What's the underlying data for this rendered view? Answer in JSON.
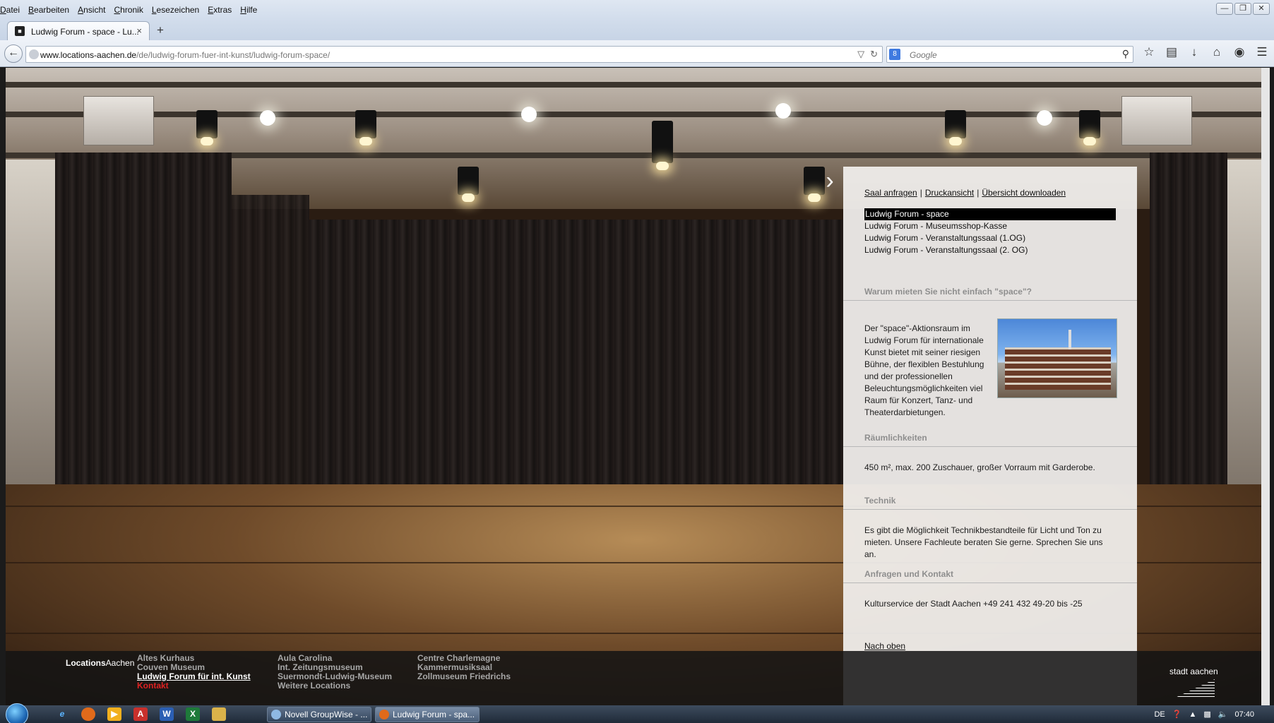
{
  "browser": {
    "menu": [
      "Datei",
      "Bearbeiten",
      "Ansicht",
      "Chronik",
      "Lesezeichen",
      "Extras",
      "Hilfe"
    ],
    "window_controls": [
      "minimize-icon",
      "restore-icon",
      "close-icon"
    ],
    "tab": {
      "title": "Ludwig Forum - space - Lu...",
      "close": "×"
    },
    "new_tab": "+",
    "url": {
      "domain": "www.locations-aachen.de",
      "path": "/de/ludwig-forum-fuer-int-kunst/ludwig-forum-space/"
    },
    "search": {
      "engine": "8",
      "placeholder": "Google"
    },
    "toolbar_icons": [
      "star-icon",
      "reading-list-icon",
      "download-icon",
      "home-icon",
      "chat-icon",
      "menu-icon"
    ]
  },
  "panel": {
    "actions": [
      "Saal anfragen",
      "Druckansicht",
      "Übersicht downloaden"
    ],
    "separator": "|",
    "rooms": [
      "Ludwig Forum - space",
      "Ludwig Forum - Museumsshop-Kasse",
      "Ludwig Forum - Veranstaltungssaal (1.OG)",
      "Ludwig Forum - Veranstaltungssaal (2. OG)"
    ],
    "active_room_index": 0,
    "why_heading": "Warum mieten Sie nicht einfach \"space\"?",
    "description": "Der \"space\"-Aktionsraum im Ludwig Forum für internationale Kunst bietet mit seiner riesigen Bühne, der flexiblen Bestuhlung und der professionellen Beleuchtungsmöglichkeiten viel Raum für Konzert, Tanz- und Theaterdarbietungen.",
    "rooms_heading": "Räumlichkeiten",
    "rooms_text": "450 m², max. 200 Zuschauer, großer Vorraum mit Garderobe.",
    "tech_heading": "Technik",
    "tech_text": "Es gibt die Möglichkeit Technikbestandteile für Licht und Ton zu mieten. Unsere Fachleute beraten Sie gerne. Sprechen Sie uns an.",
    "contact_heading": "Anfragen und Kontakt",
    "contact_text": "Kulturservice der Stadt Aachen +49 241 432 49-20 bis -25",
    "to_top": "Nach oben"
  },
  "footer": {
    "brand_a": "Locations",
    "brand_b": "Aachen",
    "col1": [
      "Altes Kurhaus",
      "Couven Museum",
      "Ludwig Forum für int. Kunst",
      "Kontakt"
    ],
    "col2": [
      "Aula Carolina",
      "Int. Zeitungsmuseum",
      "Suermondt-Ludwig-Museum",
      "Weitere Locations"
    ],
    "col3": [
      "Centre Charlemagne",
      "Kammermusiksaal",
      "Zollmuseum Friedrichs"
    ],
    "logo_text": "stadt aachen"
  },
  "taskbar": {
    "items": [
      "Novell GroupWise - ...",
      "Ludwig Forum - spa..."
    ],
    "lang": "DE",
    "time": "07:40"
  }
}
